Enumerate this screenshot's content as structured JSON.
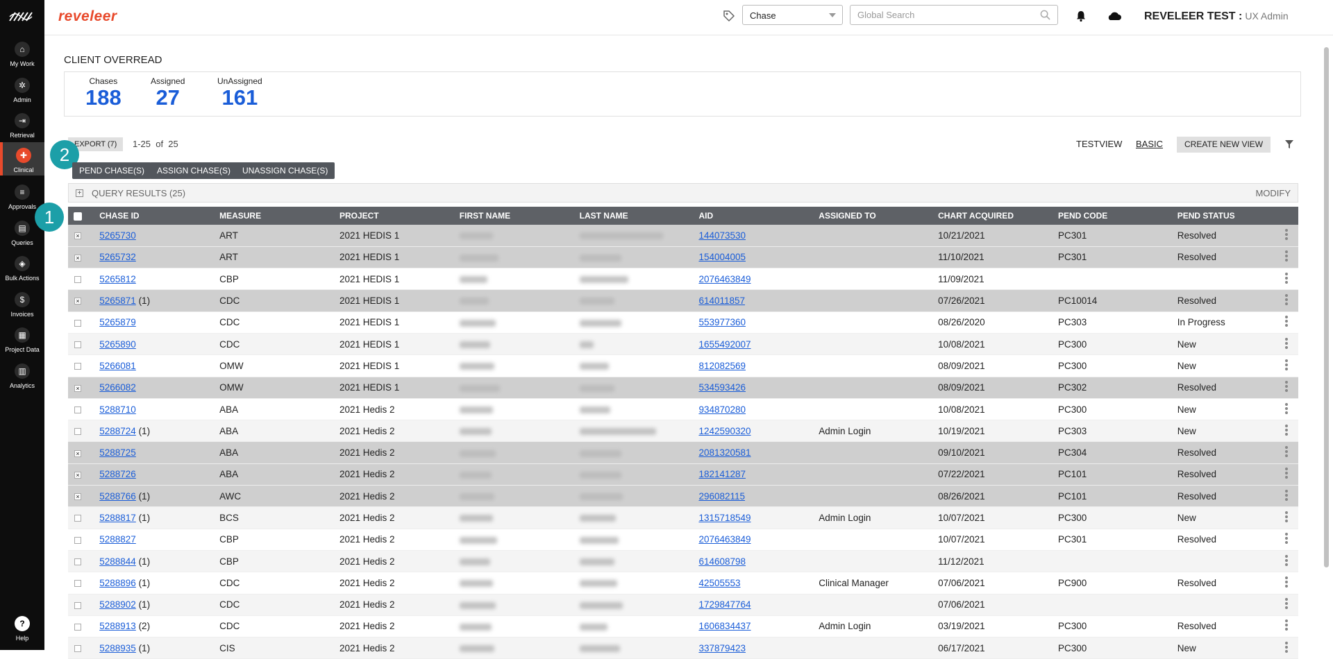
{
  "sidebar": {
    "items": [
      {
        "label": "My Work",
        "icon": "home-icon",
        "glyph": "⌂"
      },
      {
        "label": "Admin",
        "icon": "gear-icon",
        "glyph": "✲"
      },
      {
        "label": "Retrieval",
        "icon": "arrow-icon",
        "glyph": "⇥"
      },
      {
        "label": "Clinical",
        "icon": "clinical-icon",
        "glyph": "✚"
      },
      {
        "label": "Approvals",
        "icon": "list-icon",
        "glyph": "≡"
      },
      {
        "label": "Queries",
        "icon": "document-icon",
        "glyph": "▤"
      },
      {
        "label": "Bulk Actions",
        "icon": "layers-icon",
        "glyph": "◈"
      },
      {
        "label": "Invoices",
        "icon": "dollar-icon",
        "glyph": "$"
      },
      {
        "label": "Project Data",
        "icon": "grid-icon",
        "glyph": "▦"
      },
      {
        "label": "Analytics",
        "icon": "chart-icon",
        "glyph": "▥"
      }
    ],
    "help": {
      "label": "Help",
      "glyph": "?"
    }
  },
  "header": {
    "brand": "reveleer",
    "select_value": "Chase",
    "search_placeholder": "Global Search",
    "user_name": "REVELEER TEST :",
    "user_role": "UX Admin"
  },
  "page": {
    "title": "CLIENT OVERREAD",
    "stats": [
      {
        "label": "Chases",
        "value": "188"
      },
      {
        "label": "Assigned",
        "value": "27"
      },
      {
        "label": "UnAssigned",
        "value": "161"
      }
    ],
    "export_label": "EXPORT (7)",
    "count_text": "1-25  of  25",
    "badges": [
      "1",
      "2"
    ],
    "actions": {
      "pend": "PEND CHASE(S)",
      "assign": "ASSIGN CHASE(S)",
      "unassign": "UNASSIGN CHASE(S)"
    },
    "views": {
      "testview": "TESTVIEW",
      "basic": "BASIC",
      "create": "CREATE NEW VIEW"
    },
    "query_bar": {
      "title": "QUERY RESULTS (25)",
      "modify": "MODIFY"
    }
  },
  "table": {
    "columns": [
      "CHASE ID",
      "MEASURE",
      "PROJECT",
      "FIRST NAME",
      "LAST NAME",
      "AID",
      "ASSIGNED TO",
      "CHART ACQUIRED",
      "PEND CODE",
      "PEND STATUS"
    ],
    "rows": [
      {
        "selected": true,
        "chase_id": "5265730",
        "suffix": "",
        "measure": "ART",
        "project": "2021 HEDIS 1",
        "aid": "144073530",
        "assigned": "",
        "acquired": "10/21/2021",
        "pend_code": "PC301",
        "pend_status": "Resolved"
      },
      {
        "selected": true,
        "chase_id": "5265732",
        "suffix": "",
        "measure": "ART",
        "project": "2021 HEDIS 1",
        "aid": "154004005",
        "assigned": "",
        "acquired": "11/10/2021",
        "pend_code": "PC301",
        "pend_status": "Resolved"
      },
      {
        "selected": false,
        "chase_id": "5265812",
        "suffix": "",
        "measure": "CBP",
        "project": "2021 HEDIS 1",
        "aid": "2076463849",
        "assigned": "",
        "acquired": "11/09/2021",
        "pend_code": "",
        "pend_status": ""
      },
      {
        "selected": true,
        "chase_id": "5265871",
        "suffix": " (1)",
        "measure": "CDC",
        "project": "2021 HEDIS 1",
        "aid": "614011857",
        "assigned": "",
        "acquired": "07/26/2021",
        "pend_code": "PC10014",
        "pend_status": "Resolved"
      },
      {
        "selected": false,
        "chase_id": "5265879",
        "suffix": "",
        "measure": "CDC",
        "project": "2021 HEDIS 1",
        "aid": "553977360",
        "assigned": "",
        "acquired": "08/26/2020",
        "pend_code": "PC303",
        "pend_status": "In Progress"
      },
      {
        "selected": false,
        "chase_id": "5265890",
        "suffix": "",
        "measure": "CDC",
        "project": "2021 HEDIS 1",
        "aid": "1655492007",
        "assigned": "",
        "acquired": "10/08/2021",
        "pend_code": "PC300",
        "pend_status": "New"
      },
      {
        "selected": false,
        "chase_id": "5266081",
        "suffix": "",
        "measure": "OMW",
        "project": "2021 HEDIS 1",
        "aid": "812082569",
        "assigned": "",
        "acquired": "08/09/2021",
        "pend_code": "PC300",
        "pend_status": "New"
      },
      {
        "selected": true,
        "chase_id": "5266082",
        "suffix": "",
        "measure": "OMW",
        "project": "2021 HEDIS 1",
        "aid": "534593426",
        "assigned": "",
        "acquired": "08/09/2021",
        "pend_code": "PC302",
        "pend_status": "Resolved"
      },
      {
        "selected": false,
        "chase_id": "5288710",
        "suffix": "",
        "measure": "ABA",
        "project": "2021 Hedis 2",
        "aid": "934870280",
        "assigned": "",
        "acquired": "10/08/2021",
        "pend_code": "PC300",
        "pend_status": "New"
      },
      {
        "selected": false,
        "chase_id": "5288724",
        "suffix": " (1)",
        "measure": "ABA",
        "project": "2021 Hedis 2",
        "aid": "1242590320",
        "assigned": "Admin Login",
        "acquired": "10/19/2021",
        "pend_code": "PC303",
        "pend_status": "New"
      },
      {
        "selected": true,
        "chase_id": "5288725",
        "suffix": "",
        "measure": "ABA",
        "project": "2021 Hedis 2",
        "aid": "2081320581",
        "assigned": "",
        "acquired": "09/10/2021",
        "pend_code": "PC304",
        "pend_status": "Resolved"
      },
      {
        "selected": true,
        "chase_id": "5288726",
        "suffix": "",
        "measure": "ABA",
        "project": "2021 Hedis 2",
        "aid": "182141287",
        "assigned": "",
        "acquired": "07/22/2021",
        "pend_code": "PC101",
        "pend_status": "Resolved"
      },
      {
        "selected": true,
        "chase_id": "5288766",
        "suffix": " (1)",
        "measure": "AWC",
        "project": "2021 Hedis 2",
        "aid": "296082115",
        "assigned": "",
        "acquired": "08/26/2021",
        "pend_code": "PC101",
        "pend_status": "Resolved"
      },
      {
        "selected": false,
        "chase_id": "5288817",
        "suffix": " (1)",
        "measure": "BCS",
        "project": "2021 Hedis 2",
        "aid": "1315718549",
        "assigned": "Admin Login",
        "acquired": "10/07/2021",
        "pend_code": "PC300",
        "pend_status": "New"
      },
      {
        "selected": false,
        "chase_id": "5288827",
        "suffix": "",
        "measure": "CBP",
        "project": "2021 Hedis 2",
        "aid": "2076463849",
        "assigned": "",
        "acquired": "10/07/2021",
        "pend_code": "PC301",
        "pend_status": "Resolved"
      },
      {
        "selected": false,
        "chase_id": "5288844",
        "suffix": " (1)",
        "measure": "CBP",
        "project": "2021 Hedis 2",
        "aid": "614608798",
        "assigned": "",
        "acquired": "11/12/2021",
        "pend_code": "",
        "pend_status": ""
      },
      {
        "selected": false,
        "chase_id": "5288896",
        "suffix": " (1)",
        "measure": "CDC",
        "project": "2021 Hedis 2",
        "aid": "42505553",
        "assigned": "Clinical Manager",
        "acquired": "07/06/2021",
        "pend_code": "PC900",
        "pend_status": "Resolved"
      },
      {
        "selected": false,
        "chase_id": "5288902",
        "suffix": " (1)",
        "measure": "CDC",
        "project": "2021 Hedis 2",
        "aid": "1729847764",
        "assigned": "",
        "acquired": "07/06/2021",
        "pend_code": "",
        "pend_status": ""
      },
      {
        "selected": false,
        "chase_id": "5288913",
        "suffix": " (2)",
        "measure": "CDC",
        "project": "2021 Hedis 2",
        "aid": "1606834437",
        "assigned": "Admin Login",
        "acquired": "03/19/2021",
        "pend_code": "PC300",
        "pend_status": "Resolved"
      },
      {
        "selected": false,
        "chase_id": "5288935",
        "suffix": " (1)",
        "measure": "CIS",
        "project": "2021 Hedis 2",
        "aid": "337879423",
        "assigned": "",
        "acquired": "06/17/2021",
        "pend_code": "PC300",
        "pend_status": "New"
      }
    ]
  }
}
